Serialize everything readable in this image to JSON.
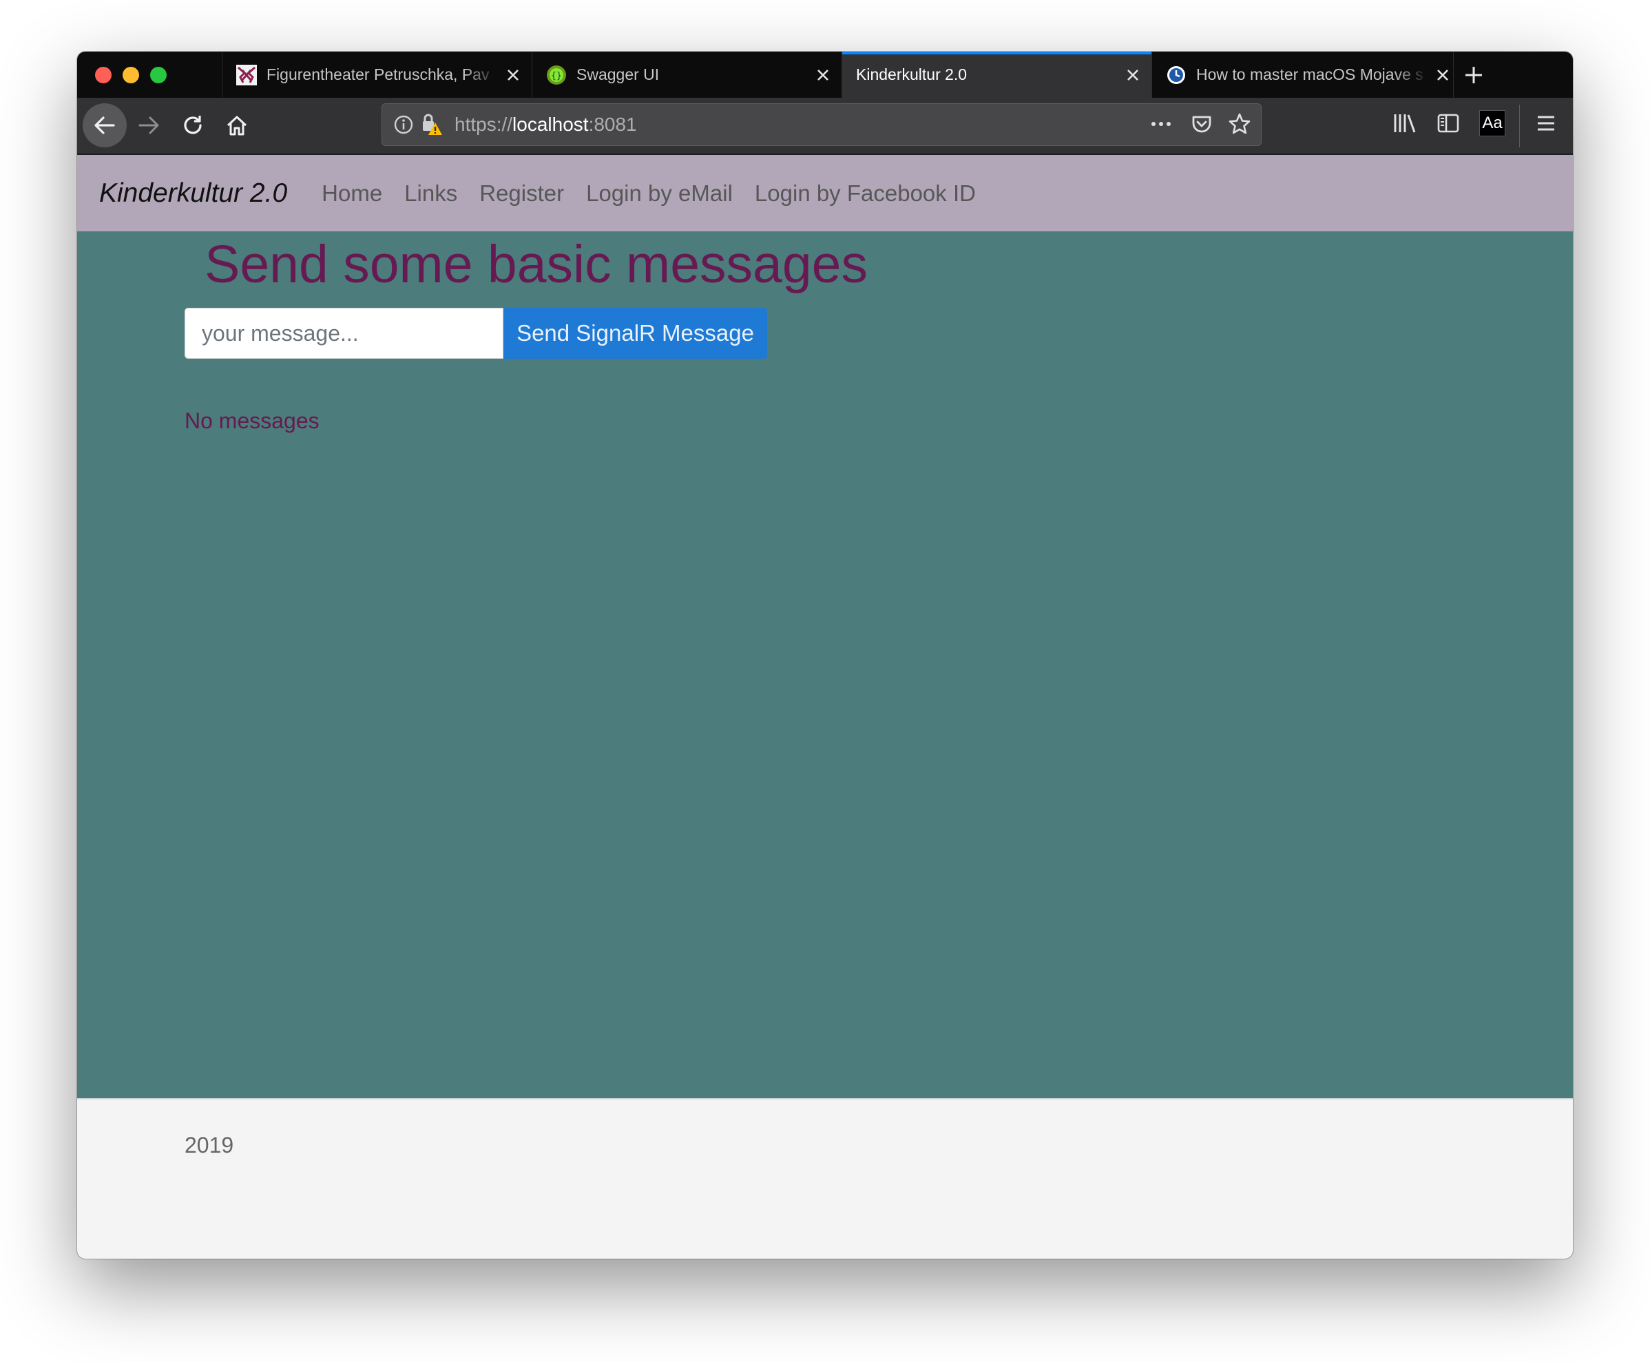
{
  "browser": {
    "tabs": [
      {
        "title": "Figurentheater Petruschka, Pav",
        "favicon": "theater-favicon",
        "active": false
      },
      {
        "title": "Swagger UI",
        "favicon": "swagger-favicon",
        "active": false
      },
      {
        "title": "Kinderkultur 2.0",
        "favicon": "",
        "active": true
      },
      {
        "title": "How to master macOS Mojave s",
        "favicon": "clock-favicon",
        "active": false
      }
    ],
    "url": {
      "scheme": "https://",
      "host": "localhost",
      "port": ":8081"
    },
    "reader_label": "Aa",
    "colors": {
      "active_tab_accent": "#0a84ff",
      "tab_strip": "#0c0c0d",
      "toolbar": "#323234"
    }
  },
  "app": {
    "brand": "Kinderkultur 2.0",
    "nav": [
      {
        "label": "Home"
      },
      {
        "label": "Links"
      },
      {
        "label": "Register"
      },
      {
        "label": "Login by eMail"
      },
      {
        "label": "Login by Facebook ID"
      }
    ],
    "heading": "Send some basic messages",
    "message_input": {
      "placeholder": "your message...",
      "value": ""
    },
    "send_button": "Send SignalR Message",
    "empty_state": "No messages",
    "footer": "2019",
    "colors": {
      "navbar": "#b2a7b9",
      "page_background": "#4c7c7b",
      "heading": "#661a51",
      "button": "#1e7ad4",
      "footer": "#f4f4f4"
    }
  }
}
